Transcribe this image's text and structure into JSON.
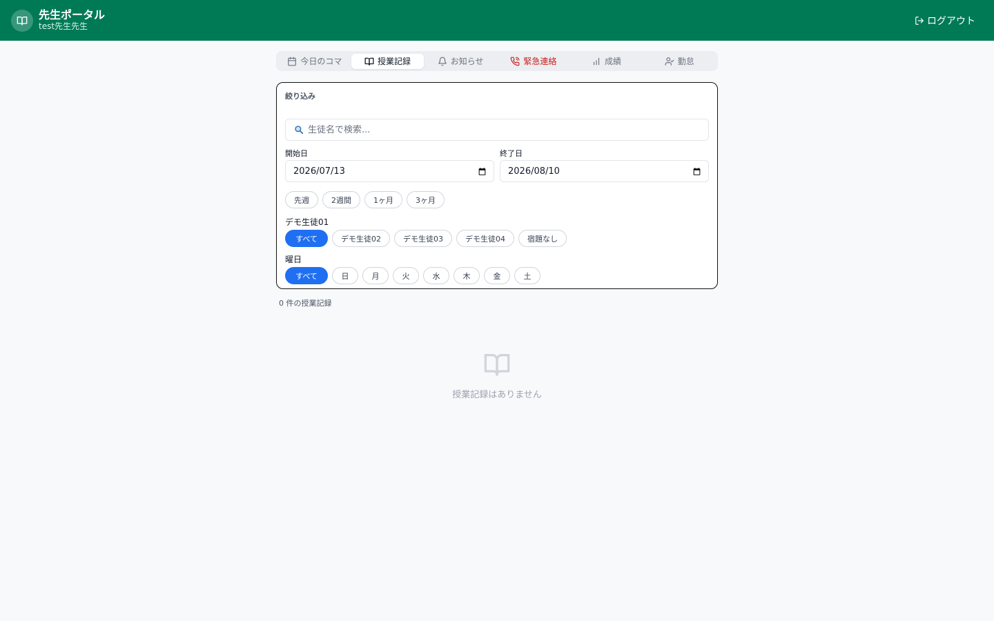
{
  "header": {
    "title": "先生ポータル",
    "subtitle": "test先生先生",
    "logout_label": "ログアウト",
    "brand_color": "#007a55"
  },
  "tabs": [
    {
      "label": "今日のコマ",
      "icon": "calendar-icon",
      "active": false
    },
    {
      "label": "授業記録",
      "icon": "book-open-icon",
      "active": true
    },
    {
      "label": "お知らせ",
      "icon": "bell-icon",
      "active": false
    },
    {
      "label": "緊急連絡",
      "icon": "phone-icon",
      "active": false,
      "color": "#c81e1e"
    },
    {
      "label": "成績",
      "icon": "bar-chart-icon",
      "active": false
    },
    {
      "label": "勤怠",
      "icon": "user-check-icon",
      "active": false
    }
  ],
  "filters": {
    "title": "絞り込み",
    "search": {
      "placeholder": "生徒名で検索...",
      "value": ""
    },
    "start_date": {
      "label": "開始日",
      "value": "2026/07/13"
    },
    "end_date": {
      "label": "終了日",
      "value": "2026/08/10"
    },
    "quick_ranges": [
      "先週",
      "2週間",
      "1ヶ月",
      "3ヶ月"
    ],
    "student": {
      "label": "デモ生徒01",
      "options": [
        "すべて",
        "デモ生徒02",
        "デモ生徒03",
        "デモ生徒04",
        "宿題なし"
      ],
      "selected": "すべて"
    },
    "weekday": {
      "label": "曜日",
      "options": [
        "すべて",
        "日",
        "月",
        "火",
        "水",
        "木",
        "金",
        "土"
      ],
      "selected": "すべて"
    },
    "accent_color": "#1f6ff2"
  },
  "results": {
    "count_text": "0 件の授業記録",
    "empty_message": "授業記録はありません",
    "empty_icon": "book-open-icon"
  }
}
